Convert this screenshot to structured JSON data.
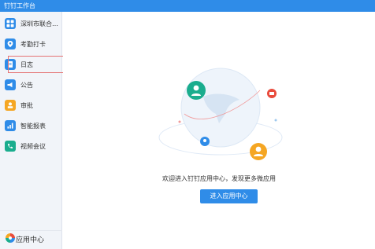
{
  "window": {
    "title": "钉钉工作台"
  },
  "sidebar": {
    "items": [
      {
        "label": "深圳市联合创...",
        "icon": "grid-icon",
        "color": "#2f8ce8"
      },
      {
        "label": "考勤打卡",
        "icon": "location-pin-icon",
        "color": "#2f8ce8"
      },
      {
        "label": "日志",
        "icon": "notebook-icon",
        "color": "#2f8ce8"
      },
      {
        "label": "公告",
        "icon": "megaphone-icon",
        "color": "#2f8ce8"
      },
      {
        "label": "审批",
        "icon": "person-stamp-icon",
        "color": "#f5a623"
      },
      {
        "label": "智能报表",
        "icon": "bar-chart-icon",
        "color": "#2f8ce8"
      },
      {
        "label": "视频会议",
        "icon": "phone-video-icon",
        "color": "#1aad8e"
      }
    ],
    "bottom": {
      "label": "应用中心",
      "icon": "pinwheel-icon"
    }
  },
  "main": {
    "welcome_text": "欢迎进入钉钉应用中心，发现更多微应用",
    "enter_button": "进入应用中心"
  },
  "colors": {
    "accent": "#2f8ce8",
    "sidebar_bg": "#f1f4f9",
    "highlight_border": "#e57373"
  }
}
